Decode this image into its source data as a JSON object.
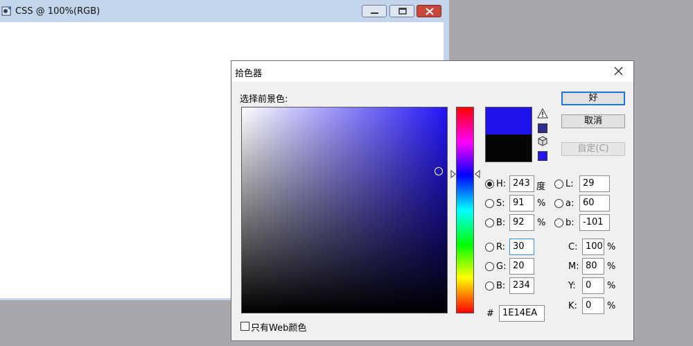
{
  "document": {
    "title": "CSS @ 100%(RGB)",
    "controls": [
      "minimize-icon",
      "maximize-icon",
      "close-icon"
    ]
  },
  "dialog": {
    "title": "拾色器",
    "select_label": "选择前景色:",
    "new_color": "#1E14EA",
    "current_color": "#050505",
    "buttons": {
      "ok": "好",
      "cancel": "取消",
      "custom": "自定(C)"
    },
    "hsb": {
      "h": {
        "label": "H:",
        "value": "243",
        "unit": "度",
        "selected": true
      },
      "s": {
        "label": "S:",
        "value": "91",
        "unit": "%"
      },
      "b": {
        "label": "B:",
        "value": "92",
        "unit": "%"
      }
    },
    "lab": {
      "l": {
        "label": "L:",
        "value": "29"
      },
      "a": {
        "label": "a:",
        "value": "60"
      },
      "b": {
        "label": "b:",
        "value": "-101"
      }
    },
    "rgb": {
      "r": {
        "label": "R:",
        "value": "30"
      },
      "g": {
        "label": "G:",
        "value": "20"
      },
      "b": {
        "label": "B:",
        "value": "234"
      }
    },
    "cmyk": {
      "c": {
        "label": "C:",
        "value": "100",
        "unit": "%"
      },
      "m": {
        "label": "M:",
        "value": "80",
        "unit": "%"
      },
      "y": {
        "label": "Y:",
        "value": "0",
        "unit": "%"
      },
      "k": {
        "label": "K:",
        "value": "0",
        "unit": "%"
      }
    },
    "hex": {
      "label": "#",
      "value": "1E14EA"
    },
    "web_only": {
      "label": "只有Web颜色",
      "checked": false
    }
  }
}
